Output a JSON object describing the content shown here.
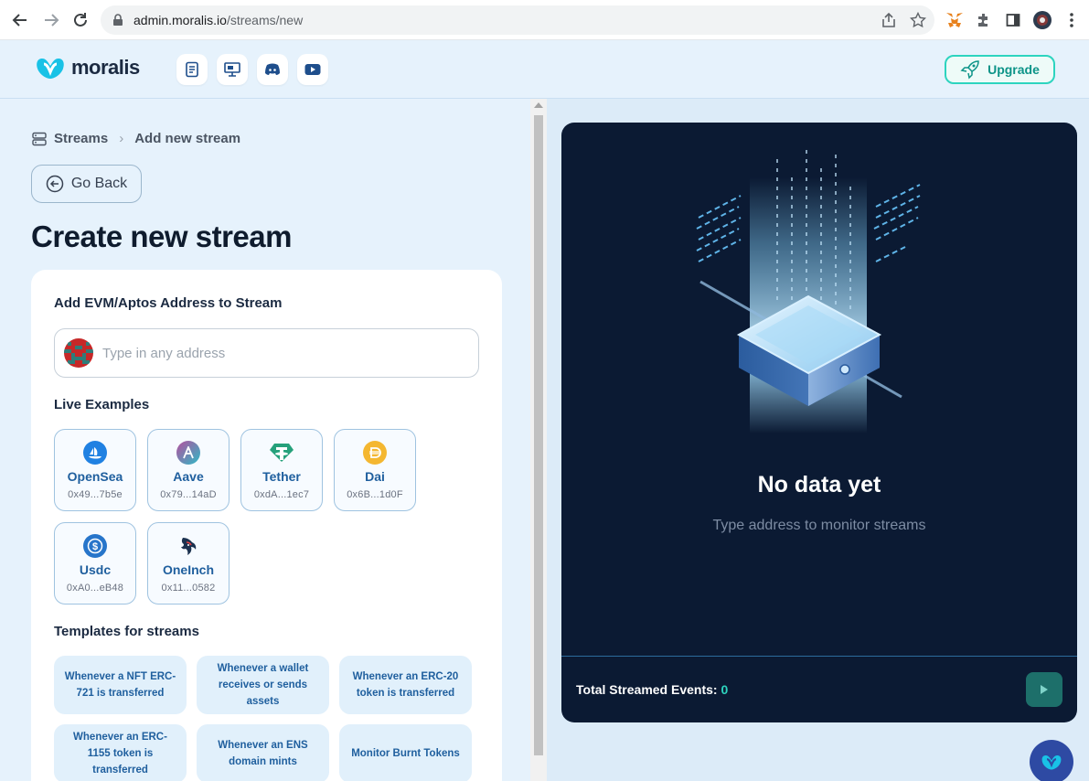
{
  "browser": {
    "url_host": "admin.moralis.io",
    "url_path": "/streams/new"
  },
  "header": {
    "logo_text": "moralis",
    "upgrade_label": "Upgrade"
  },
  "breadcrumb": {
    "root": "Streams",
    "current": "Add new stream"
  },
  "go_back_label": "Go Back",
  "page_title": "Create new stream",
  "form": {
    "address_label": "Add EVM/Aptos Address to Stream",
    "address_placeholder": "Type in any address",
    "examples_label": "Live Examples",
    "examples": [
      {
        "name": "OpenSea",
        "addr": "0x49...7b5e",
        "icon": "opensea-icon",
        "color": "#2081e2"
      },
      {
        "name": "Aave",
        "addr": "0x79...14aD",
        "icon": "aave-icon",
        "color": "#7b6bd6"
      },
      {
        "name": "Tether",
        "addr": "0xdA...1ec7",
        "icon": "tether-icon",
        "color": "#26a17b"
      },
      {
        "name": "Dai",
        "addr": "0x6B...1d0F",
        "icon": "dai-icon",
        "color": "#f4b731"
      },
      {
        "name": "Usdc",
        "addr": "0xA0...eB48",
        "icon": "usdc-icon",
        "color": "#2775ca"
      },
      {
        "name": "OneInch",
        "addr": "0x11...0582",
        "icon": "oneinch-icon",
        "color": "#1b314f"
      }
    ],
    "templates_label": "Templates for streams",
    "templates": [
      "Whenever a NFT ERC-721 is transferred",
      "Whenever a wallet receives or sends assets",
      "Whenever an ERC-20 token is transferred",
      "Whenever an ERC-1155 token is transferred",
      "Whenever an ENS domain mints",
      "Monitor Burnt Tokens"
    ]
  },
  "preview": {
    "title": "No data yet",
    "subtitle": "Type address to monitor streams",
    "total_label": "Total Streamed Events:",
    "total_value": "0"
  },
  "colors": {
    "accent": "#2dd4bf",
    "panel_dark": "#0b1a33",
    "link_blue": "#1f5f9e"
  }
}
